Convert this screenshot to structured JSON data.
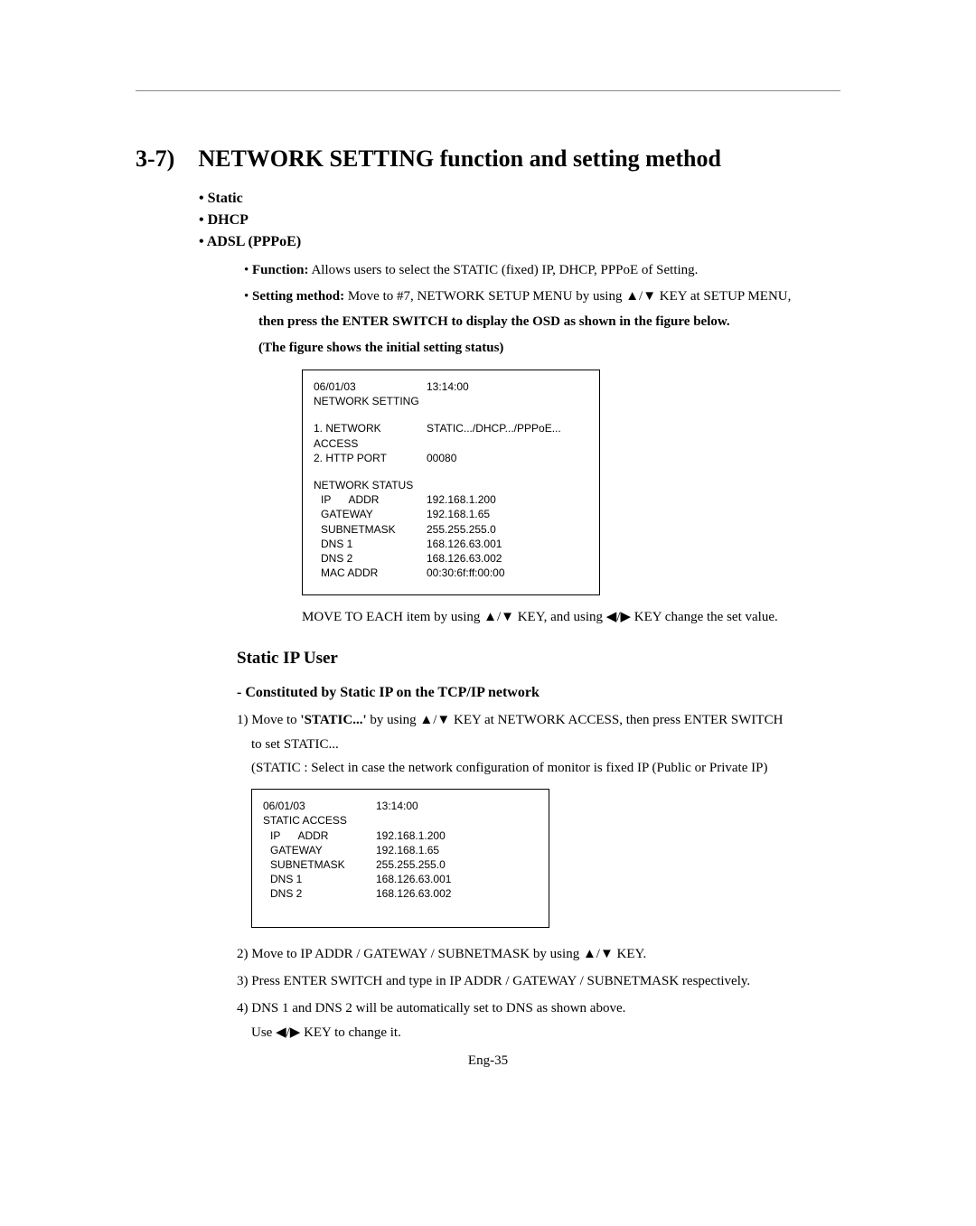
{
  "heading": {
    "num": "3-7)",
    "title": "NETWORK SETTING function and setting method"
  },
  "modes": {
    "static": "Static",
    "dhcp": "DHCP",
    "adsl": "ADSL (PPPoE)"
  },
  "func": {
    "label": "Function:",
    "text": " Allows users to select the STATIC (fixed) IP, DHCP, PPPoE of Setting."
  },
  "setting": {
    "label": "Setting method:",
    "line1": " Move to #7, NETWORK SETUP MENU by using ▲/▼ KEY at SETUP MENU,",
    "line2": "then press the ENTER SWITCH to display the OSD as shown in the figure below.",
    "line3": "(The figure shows the initial setting status)"
  },
  "menu1": {
    "date": "06/01/03",
    "time": "13:14:00",
    "title": "NETWORK SETTING",
    "item1_label": "1. NETWORK ACCESS",
    "item1_value": "STATIC.../DHCP.../PPPoE...",
    "item2_label": "2. HTTP PORT",
    "item2_value": "00080",
    "status_hdr": "NETWORK STATUS",
    "rows": {
      "ip_label": "IP      ADDR",
      "ip_value": "192.168.1.200",
      "gw_label": "GATEWAY",
      "gw_value": "192.168.1.65",
      "sn_label": "SUBNETMASK",
      "sn_value": "255.255.255.0",
      "dns1_label": "DNS 1",
      "dns1_value": "168.126.63.001",
      "dns2_label": "DNS 2",
      "dns2_value": "168.126.63.002",
      "mac_label": "MAC ADDR",
      "mac_value": "00:30:6f:ff:00:00"
    }
  },
  "move_note": "MOVE TO EACH item by using ▲/▼ KEY, and using ◀/▶ KEY change the set value.",
  "static_user": {
    "hdr": "Static IP User",
    "subhdr": "- Constituted by Static IP on the TCP/IP network",
    "step1a": "1) Move to ",
    "step1b": "'STATIC...'",
    "step1c": " by using ▲/▼ KEY at  NETWORK ACCESS, then press ENTER SWITCH",
    "step1d": "to set STATIC...",
    "step1e": "(STATIC : Select in case the network configuration of monitor is fixed IP (Public or Private IP)"
  },
  "menu2": {
    "date": "06/01/03",
    "time": "13:14:00",
    "title": "STATIC ACCESS",
    "rows": {
      "ip_label": "IP      ADDR",
      "ip_value": "192.168.1.200",
      "gw_label": "GATEWAY",
      "gw_value": "192.168.1.65",
      "sn_label": "SUBNETMASK",
      "sn_value": "255.255.255.0",
      "dns1_label": "DNS 1",
      "dns1_value": "168.126.63.001",
      "dns2_label": "DNS 2",
      "dns2_value": "168.126.63.002"
    }
  },
  "steps_after": {
    "s2": "2) Move to IP ADDR / GATEWAY / SUBNETMASK by using ▲/▼ KEY.",
    "s3": "3) Press ENTER SWITCH and type in IP ADDR / GATEWAY / SUBNETMASK respectively.",
    "s4": "4) DNS 1 and DNS 2 will be automatically set to DNS as shown above.",
    "s4b": "Use ◀/▶ KEY to change it."
  },
  "page_foot": "Eng-35"
}
